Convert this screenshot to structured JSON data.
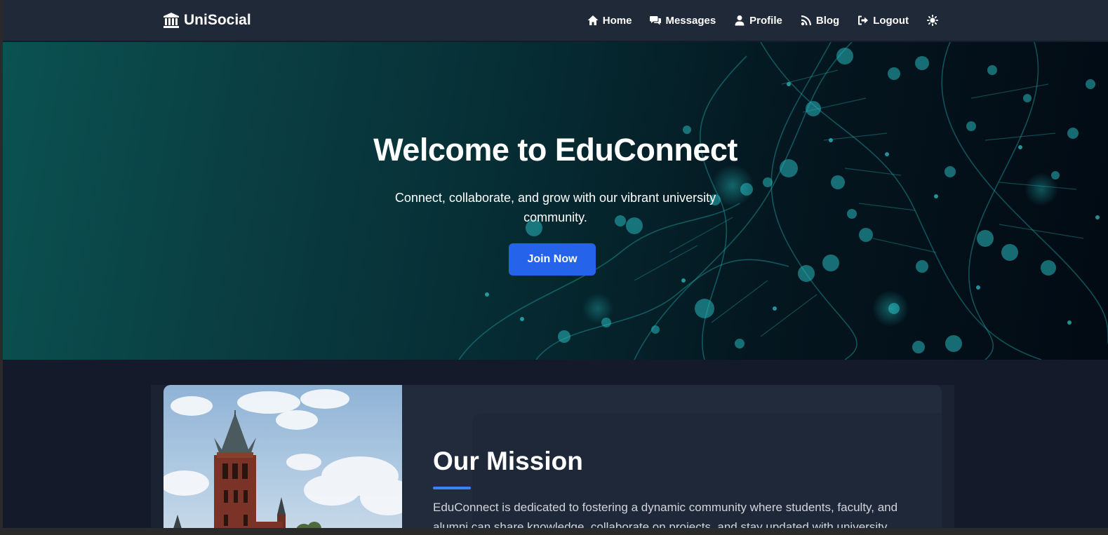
{
  "brand": {
    "name": "UniSocial",
    "icon": "university-icon"
  },
  "nav": [
    {
      "label": "Home",
      "icon": "home-icon"
    },
    {
      "label": "Messages",
      "icon": "comments-icon"
    },
    {
      "label": "Profile",
      "icon": "user-icon"
    },
    {
      "label": "Blog",
      "icon": "blog-icon"
    },
    {
      "label": "Logout",
      "icon": "logout-icon"
    }
  ],
  "theme_toggle": {
    "icon": "sun-icon"
  },
  "hero": {
    "title": "Welcome to EduConnect",
    "subtitle": "Connect, collaborate, and grow with our vibrant university community.",
    "cta": "Join Now"
  },
  "mission": {
    "title": "Our Mission",
    "text": "EduConnect is dedicated to fostering a dynamic community where students, faculty, and alumni can share knowledge, collaborate on projects, and stay updated with university"
  },
  "colors": {
    "navbar": "#1f2937",
    "accent": "#2563eb",
    "page_bg": "#141a29",
    "card_bg": "#222b3b"
  }
}
